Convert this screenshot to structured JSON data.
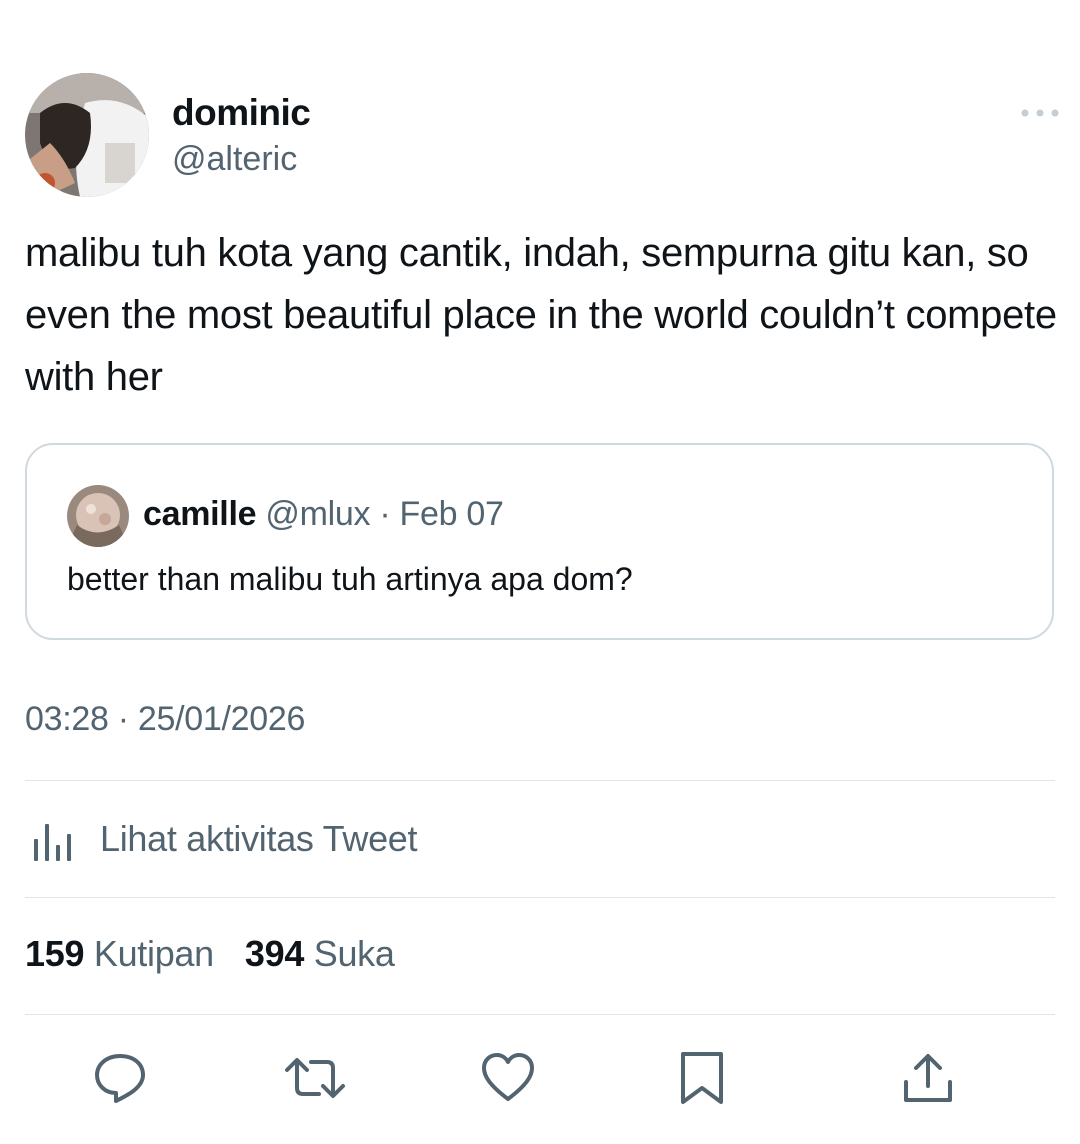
{
  "author": {
    "display_name": "dominic",
    "handle": "@alteric"
  },
  "tweet": {
    "text": "malibu tuh kota yang cantik, indah, sempurna gitu kan, so even the most beautiful place in the world couldn’t compete with her",
    "timestamp": "03:28 · 25/01/2026"
  },
  "quoted_tweet": {
    "display_name": "camille",
    "handle": "@mlux",
    "date": "· Feb 07",
    "text": "better than malibu tuh artinya apa dom?"
  },
  "activity": {
    "label": "Lihat aktivitas Tweet",
    "icon": "bar-chart-icon"
  },
  "stats": {
    "quotes_count": "159",
    "quotes_label": "Kutipan",
    "likes_count": "394",
    "likes_label": "Suka"
  },
  "actions": [
    {
      "name": "reply",
      "icon": "speech-bubble-icon"
    },
    {
      "name": "retweet",
      "icon": "retweet-icon"
    },
    {
      "name": "like",
      "icon": "heart-icon"
    },
    {
      "name": "bookmark",
      "icon": "bookmark-icon"
    },
    {
      "name": "share",
      "icon": "share-icon"
    }
  ],
  "colors": {
    "text_primary": "#0f1419",
    "text_secondary": "#536471",
    "border": "#cfd9de"
  }
}
